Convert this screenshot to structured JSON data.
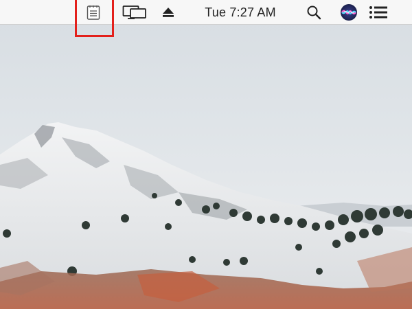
{
  "menubar": {
    "clock": "Tue 7:27 AM",
    "icons": {
      "notes": "notes-icon",
      "display": "display-mirroring-icon",
      "eject": "eject-icon",
      "search": "spotlight-search-icon",
      "siri": "siri-icon",
      "notification": "notification-center-icon"
    },
    "highlight_color": "#e3201b"
  },
  "desktop": {
    "wallpaper": "mountain-wallpaper"
  }
}
